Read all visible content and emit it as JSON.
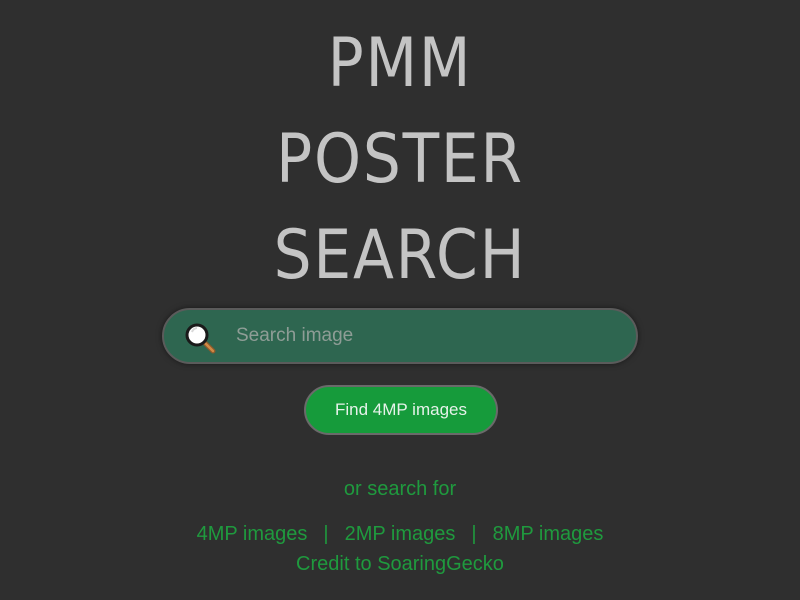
{
  "title": {
    "line1": "PMM",
    "line2": "POSTER",
    "line3": "SEARCH"
  },
  "search": {
    "placeholder": "Search image",
    "value": "",
    "icon": "magnifier-icon"
  },
  "find_button": {
    "label": "Find 4MP images"
  },
  "alt_search": {
    "prompt": "or search for",
    "links": [
      "4MP images",
      "2MP images",
      "8MP images"
    ],
    "separator": "|"
  },
  "credit": "Credit to SoaringGecko",
  "colors": {
    "background": "#2f2f2f",
    "title": "#c4c4c4",
    "search_bar": "#2e6650",
    "button": "#169b3b",
    "link_text": "#1f9a3e"
  }
}
